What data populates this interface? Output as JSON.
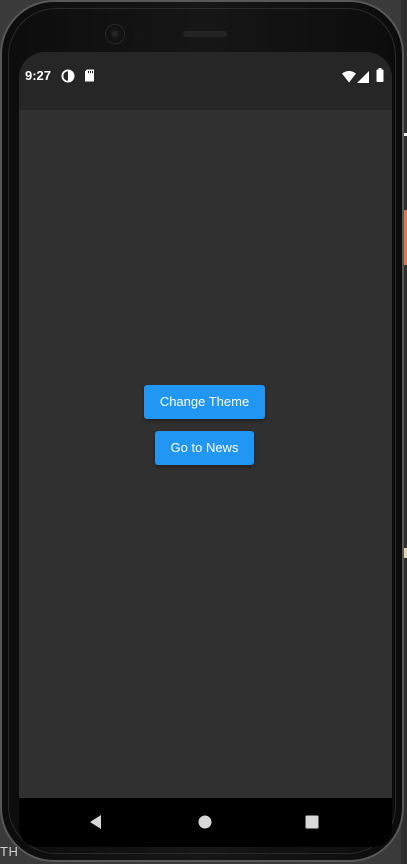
{
  "status_bar": {
    "time": "9:27",
    "icons": [
      "data-saver-icon",
      "sd-card-icon",
      "wifi-icon",
      "signal-icon",
      "battery-icon"
    ]
  },
  "main": {
    "change_theme_label": "Change Theme",
    "go_to_news_label": "Go to News"
  },
  "nav_bar": {
    "icons": [
      "back-icon",
      "home-icon",
      "recents-icon"
    ]
  },
  "background": {
    "partial_text": "TH"
  },
  "colors": {
    "button": "#2196f3",
    "button_text": "#ffffff",
    "screen_background": "#303030",
    "status_bar": "#262626",
    "nav_bar": "#000000"
  }
}
